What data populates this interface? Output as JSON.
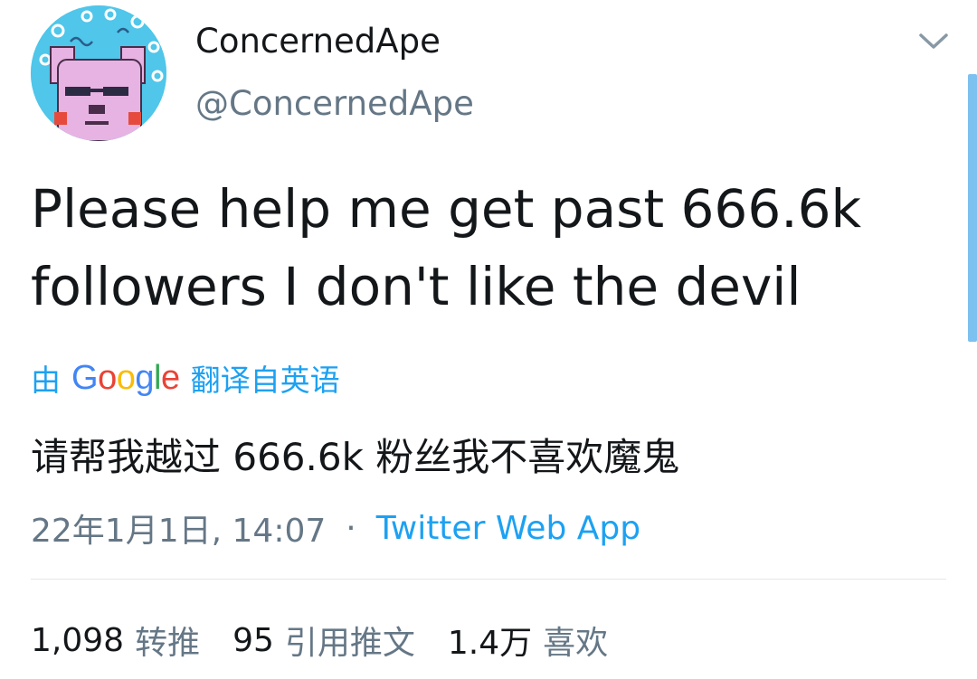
{
  "user": {
    "display_name": "ConcernedApe",
    "handle": "@ConcernedApe"
  },
  "tweet": {
    "text_line1": "Please help me get past 666.6k",
    "text_line2": "followers I don't like the devil"
  },
  "translation": {
    "prefix": "由",
    "provider": "Google",
    "suffix": "翻译自英语",
    "translated_text": "请帮我越过 666.6k 粉丝我不喜欢魔鬼"
  },
  "meta": {
    "timestamp": "22年1月1日, 14:07",
    "separator": "·",
    "source": "Twitter Web App"
  },
  "stats": {
    "retweets_count": "1,098",
    "retweets_label": "转推",
    "quotes_count": "95",
    "quotes_label": "引用推文",
    "likes_count": "1.4万",
    "likes_label": "喜欢"
  },
  "icons": {
    "menu": "chevron-down-icon",
    "avatar": "avatar-image"
  },
  "colors": {
    "link_blue": "#1da1f2",
    "secondary_gray": "#657786",
    "text_dark": "#14171a",
    "divider": "#e1e8ed"
  }
}
